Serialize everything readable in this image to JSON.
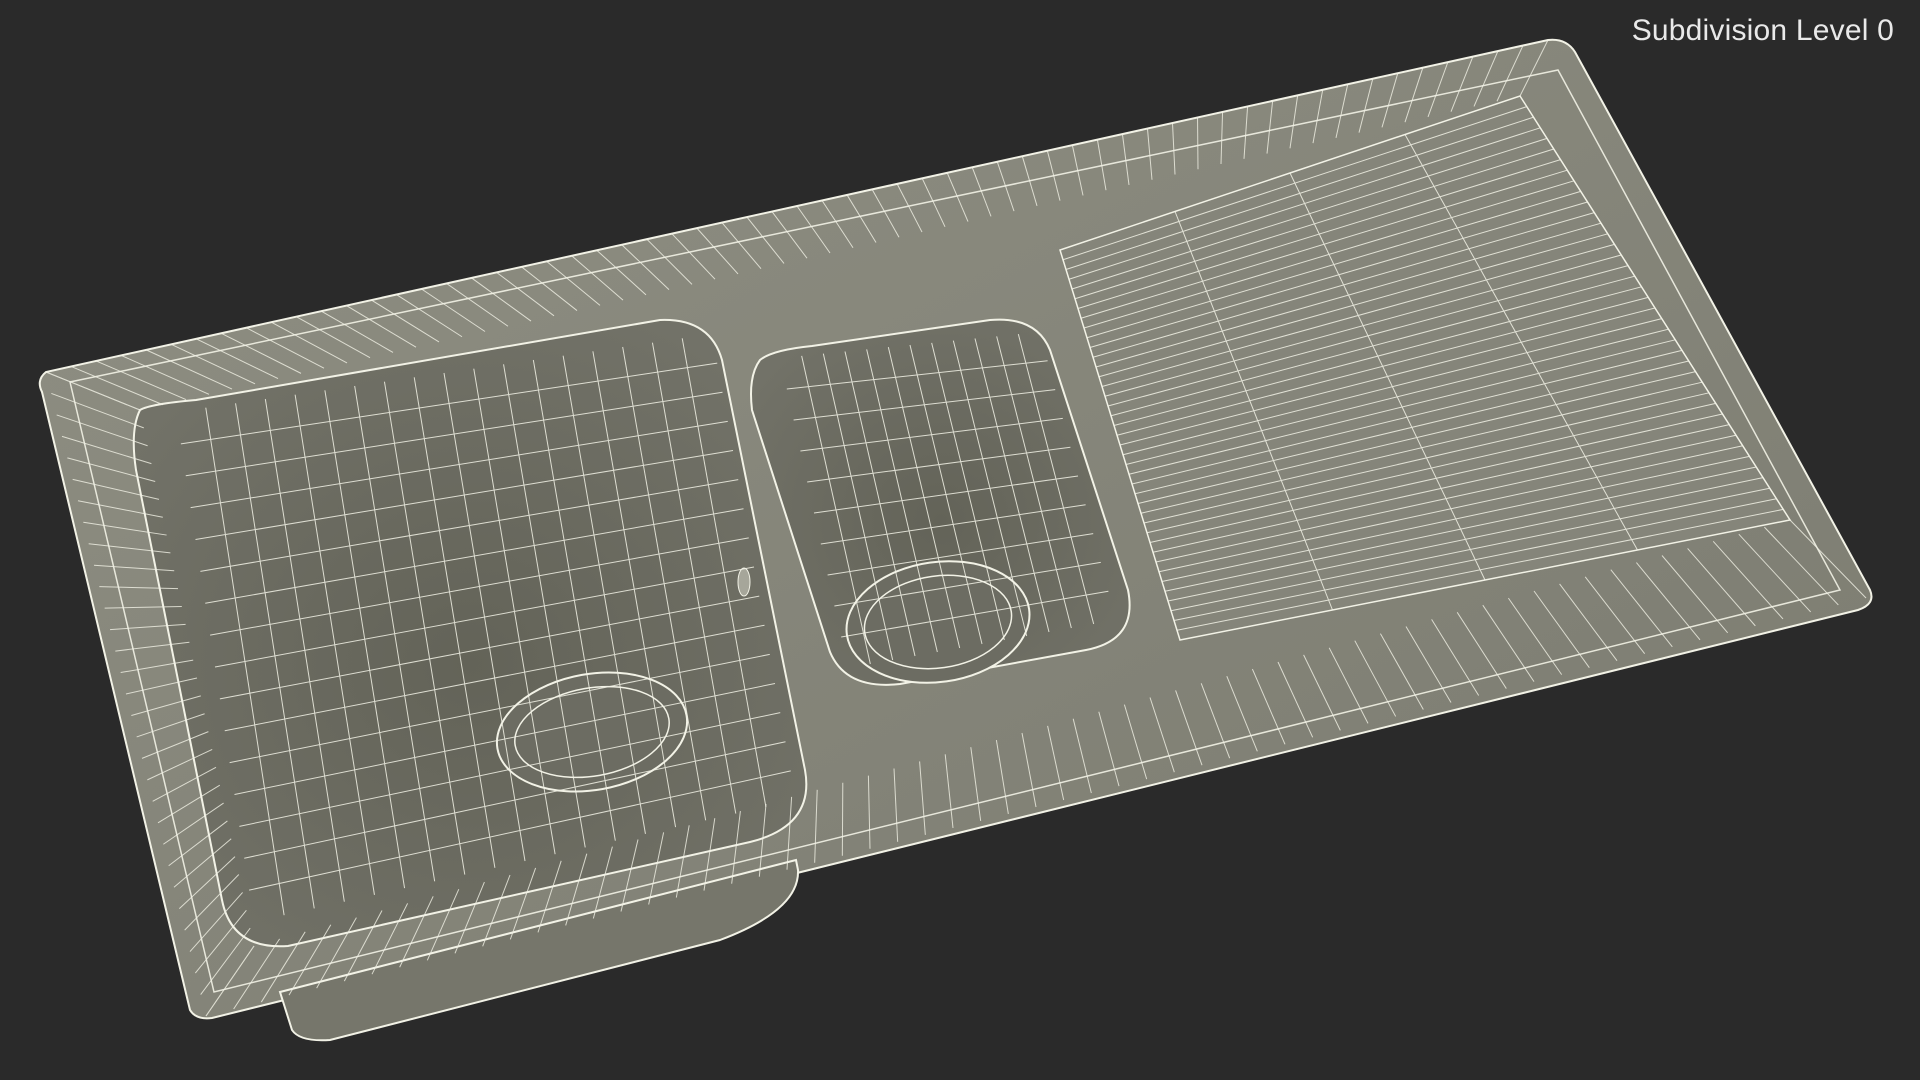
{
  "viewport": {
    "overlay_label": "Subdivision Level 0",
    "background_color": "#2a2a2a",
    "wire_color": "#f2f2e6",
    "surface_color": "#7f7f73",
    "model_subject": "double-bowl-kitchen-sink",
    "display_mode": "wireframe-on-shaded"
  }
}
